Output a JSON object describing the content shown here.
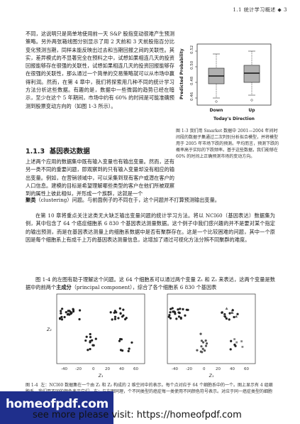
{
  "header": {
    "text": "1.1  统计学习概述  ◆  3"
  },
  "intro_paragraph": "不同，这说明只是简单地使用前一天 S&P 股指变动很难产生预测策略。另外两张箱线图分别显示了用 2 天前和 3 天前股指百分比变化预测当期，同样未能反映出过去和当期回报之间的关联性。其实，差异模式的不显著完全在预料之中，试想如果相连几天的投资回报能够存在很强的关联性，试想如果相连几天的投资回报能够存在很强的关联性，那么通过一个简单的交易策略就可以从市场中赢得利润。然而，在第 4 章中，我们将探索用几种不同的统计学习方法分析这些数据。有趣的是，数据中一些微弱的趋势已经在暗示，至少在这个 5 年期间，市场中约有 60% 的时间是可能准确预测到股票变动方向的（如图 1-3 所示）。",
  "fig13": {
    "ylabel": "Predicted Probability",
    "yticks": [
      "0.46",
      "0.48",
      "0.50",
      "0.52"
    ],
    "categories": [
      "Down",
      "Up"
    ],
    "xlabel": "Today's Direction",
    "caption_label": "图 1-3",
    "caption": "我们用 Smarket 数据中 2001—2004 年间时间段的数据子集通过二次判别分析拟合模型，并将模型用于 2005 年市场下跌的预测。平均而言，预测下跌的概率高于实际的下跌频率。基于这些数据，我们能够在 60% 的时间上正确预测市场的变动方向。"
  },
  "section": {
    "number": "1.1.3",
    "title": "基因表达数据"
  },
  "para2": "上述两个应用的数据集中既有输入变量也有输出变量。然而，还有另一类不同的重要问题，即观察到的只有输入变量却没有相应的输出变量。例如，在营销领域中，可以采集到现有客户或潜在客户的人口信息。建模的目标是希望理解哪些类型的客户在他们所被观察到的属性上彼此相似，并形成一个族群，这就是一个",
  "para2_bold": "聚类",
  "para2_tail": "（clustering）问题。与前面例子的不同在于，这个问题并不打算预测输出变量。",
  "para3": "在第 10 章将重点关注这类无大缺乏输出变量问题的统计学习方法。将以 NCI60（基因表达）数据集为例，其中包含了 64 个癌症细胞系 6 830 个基因表达测量数据。这个例子中我们感兴趣的并不是要对某个指定的输出预测，而是在基因表达测量上的细胞系数据中是否有聚群存在。这是一个比较困难的问题，其中一个原因是每个细胞系上有成千上万的基因表达测量信息，这增加了通过可视化方法分辨不同聚群的难度。",
  "para4": "图 1-4 的左图有助于理解这个问题。这 64 个细胞系可以通过两个变量 Z₁ 和 Z₂ 来表达，这两个变量是数据中的前两个",
  "para4_bold": "主成分",
  "para4_tail": "（principal component），综合了各个细胞系 6 830 个基因表",
  "fig14": {
    "xlabel": "Z₁",
    "ylabel": "Z₂",
    "xticks": [
      "-40",
      "-20",
      "0",
      "20",
      "40",
      "60"
    ],
    "yticks": [
      "-60",
      "-40",
      "-20",
      "0",
      "20"
    ],
    "caption_label": "图 1-4",
    "caption": "左：NCI60 数据集在一个由 Z₁ 和 Z₂ 构成的 2 维空间中的表示。每个点对应于 64 个细胞系中的一个。图上显示有 4 组细胞系，我们用不同的颜色表示它们。右：与左图同理，个不同类型的癌症每一类使用不同颜色符号表示。对应于同一癌症类型的细胞系在这维空间中往往会比较靠近彼此。"
  },
  "footer": {
    "logo": "homeofpdf.com",
    "note": "see more please visit: https://homeofpdf.com"
  }
}
